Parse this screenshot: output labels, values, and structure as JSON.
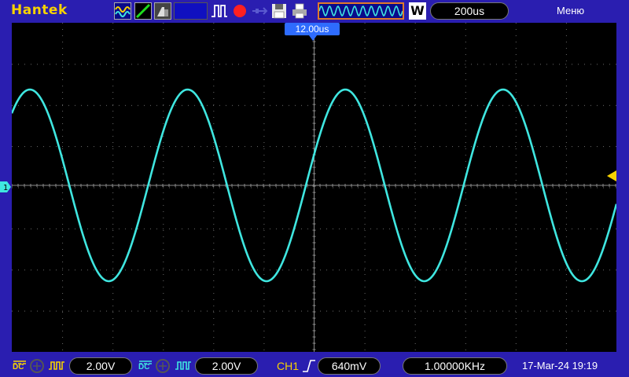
{
  "brand": "Hantek",
  "toolbar": {
    "icons": [
      "wave-auto-icon",
      "ramp-icon",
      "persist-icon",
      "blank-panel",
      "pulse-icon",
      "record-icon",
      "usb-icon",
      "save-icon",
      "print-icon"
    ],
    "record_color": "#ff2020",
    "w_label": "W",
    "timebase": "200us",
    "menu_label": "Меню"
  },
  "screen": {
    "time_offset": "12.00us",
    "waveform_color": "#3fe6e0",
    "channel_marker": "1",
    "trigger_marker_color": "#f7d200"
  },
  "status": {
    "ch1_coupling": "DC",
    "ch1_scale": "2.00V",
    "ch2_coupling": "DC",
    "ch2_scale": "2.00V",
    "trigger_source": "CH1",
    "trigger_level": "640mV",
    "frequency": "1.00000KHz",
    "datetime": "17-Mar-24 19:19"
  }
}
